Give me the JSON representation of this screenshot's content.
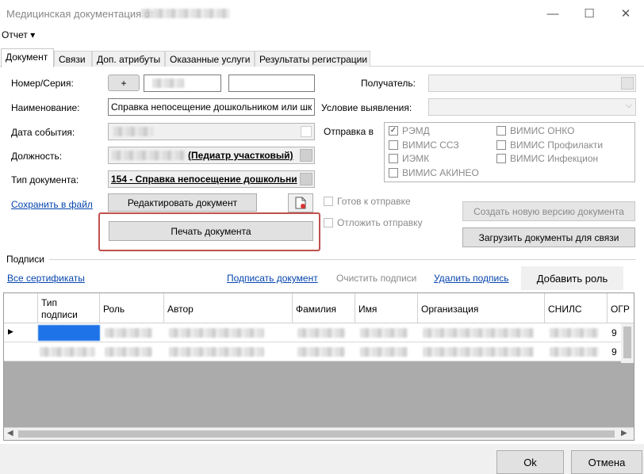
{
  "window": {
    "title": "Медицинская документация от",
    "minimize": "—",
    "maximize": "☐",
    "close": "✕"
  },
  "menu": {
    "report": "Отчет ▾"
  },
  "tabs": [
    {
      "label": "Документ",
      "active": true
    },
    {
      "label": "Связи"
    },
    {
      "label": "Доп. атрибуты"
    },
    {
      "label": "Оказанные услуги"
    },
    {
      "label": "Результаты регистрации"
    }
  ],
  "form": {
    "number_label": "Номер/Серия:",
    "plus_button": "+",
    "name_label": "Наименование:",
    "name_value": "Справка непосещение дошкольником или шк",
    "event_date_label": "Дата события:",
    "position_label": "Должность:",
    "position_value": "(Педиатр участковый)",
    "doc_type_label": "Тип документа:",
    "doc_type_value": "154 - Справка непосещение дошкольни",
    "save_to_file": "Сохранить в файл",
    "edit_document": "Редактировать документ",
    "print_document": "Печать документа",
    "recipient_label": "Получатель:",
    "detection_label": "Условие выявления:",
    "send_to_label": "Отправка в",
    "send_targets": [
      {
        "label": "РЭМД",
        "checked": true
      },
      {
        "label": "ВИМИС ОНКО",
        "checked": false
      },
      {
        "label": "ВИМИС ССЗ",
        "checked": false
      },
      {
        "label": "ВИМИС Профилакти",
        "checked": false
      },
      {
        "label": "ИЭМК",
        "checked": false
      },
      {
        "label": "ВИМИС Инфекцион",
        "checked": false
      },
      {
        "label": "ВИМИС АКИНЕО",
        "checked": false
      }
    ],
    "ready_to_send": "Готов к отправке",
    "postpone_send": "Отложить отправку",
    "create_new_version": "Создать новую версию документа",
    "load_docs_for_link": "Загрузить документы для связи"
  },
  "signatures": {
    "group_title": "Подписи",
    "all_certificates": "Все сертификаты",
    "sign_document": "Подписать документ",
    "clear_signatures": "Очистить подписи",
    "delete_signature": "Удалить подпись",
    "add_role": "Добавить роль",
    "columns": [
      "Тип подписи",
      "Роль",
      "Автор",
      "Фамилия",
      "Имя",
      "Организация",
      "СНИЛС",
      "ОГР"
    ],
    "row_marker": "▶",
    "cell_partial": "9"
  },
  "footer": {
    "ok": "Ok",
    "cancel": "Отмена"
  },
  "colors": {
    "highlight_border": "#c0504d",
    "link": "#0645ad",
    "selection": "#1e73e8"
  }
}
